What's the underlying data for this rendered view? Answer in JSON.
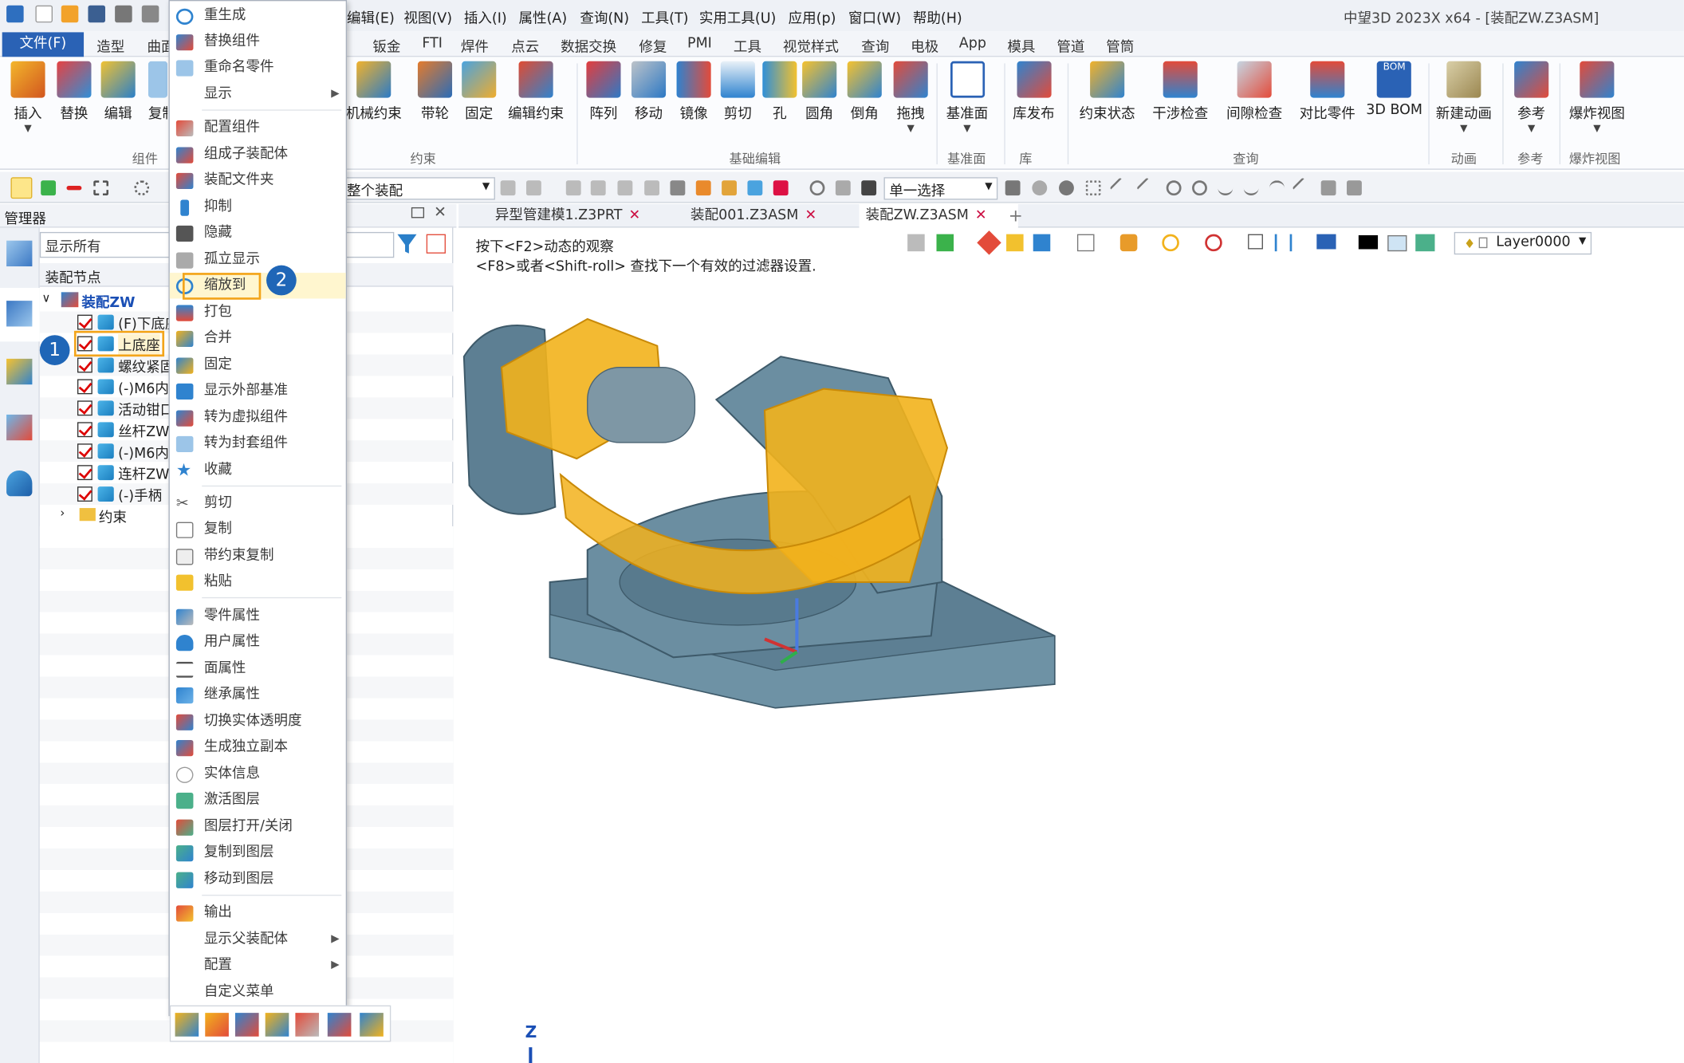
{
  "window": {
    "app_title": "中望3D 2023X x64 - [装配ZW.Z3ASM]"
  },
  "menubar": {
    "items": [
      "编辑(E)",
      "视图(V)",
      "插入(I)",
      "属性(A)",
      "查询(N)",
      "工具(T)",
      "实用工具(U)",
      "应用(p)",
      "窗口(W)",
      "帮助(H)"
    ]
  },
  "ribbon_tabs": {
    "file": "文件(F)",
    "items": [
      "造型",
      "曲面",
      "钣金",
      "FTI",
      "焊件",
      "点云",
      "数据交换",
      "修复",
      "PMI",
      "工具",
      "视觉样式",
      "查询",
      "电极",
      "App",
      "模具",
      "管道",
      "管筒"
    ]
  },
  "ribbon": {
    "buttons": [
      "插入",
      "替换",
      "编辑",
      "复制",
      "机械约束",
      "带轮",
      "固定",
      "编辑约束",
      "阵列",
      "移动",
      "镜像",
      "剪切",
      "孔",
      "圆角",
      "倒角",
      "拖拽",
      "基准面",
      "库发布",
      "约束状态",
      "干涉检查",
      "间隙检查",
      "对比零件",
      "3D BOM",
      "新建动画",
      "参考",
      "爆炸视图"
    ],
    "groups": [
      "组件",
      "约束",
      "基础编辑",
      "基准面",
      "库",
      "查询",
      "动画",
      "参考",
      "爆炸视图"
    ]
  },
  "toolbar": {
    "filter_value": "整个装配",
    "select_mode": "单一选择"
  },
  "manager": {
    "title": "管理器",
    "search_placeholder": "显示所有",
    "tree_header": "装配节点",
    "root": "装配ZW",
    "nodes": [
      "(F)下底座",
      "上底座",
      "螺纹紧固",
      "(-)M6内",
      "活动钳口",
      "丝杆ZW",
      "(-)M6内",
      "连杆ZW",
      "(-)手柄",
      "约束"
    ]
  },
  "doc_tabs": [
    "异型管建模1.Z3PRT",
    "装配001.Z3ASM",
    "装配ZW.Z3ASM"
  ],
  "viewport": {
    "hint_line1": "按下<F2>动态的观察",
    "hint_line2": "<F8>或者<Shift-roll> 查找下一个有效的过滤器设置.",
    "layer": "Layer0000",
    "axis_label": "Z"
  },
  "context_menu": {
    "items": [
      "重生成",
      "替换组件",
      "重命名零件",
      "显示",
      "配置组件",
      "组成子装配体",
      "装配文件夹",
      "抑制",
      "隐藏",
      "孤立显示",
      "缩放到",
      "打包",
      "合并",
      "固定",
      "显示外部基准",
      "转为虚拟组件",
      "转为封套组件",
      "收藏",
      "剪切",
      "复制",
      "带约束复制",
      "粘贴",
      "零件属性",
      "用户属性",
      "面属性",
      "继承属性",
      "切换实体透明度",
      "生成独立副本",
      "实体信息",
      "激活图层",
      "图层打开/关闭",
      "复制到图层",
      "移动到图层",
      "输出",
      "显示父装配体",
      "配置",
      "自定义菜单"
    ],
    "highlighted": "缩放到"
  },
  "callouts": [
    "1",
    "2"
  ],
  "colors": {
    "accent": "#2a62b5",
    "highlight": "#f3a51b",
    "model_gray": "#5d7f93",
    "model_yellow": "#f2b21c"
  }
}
